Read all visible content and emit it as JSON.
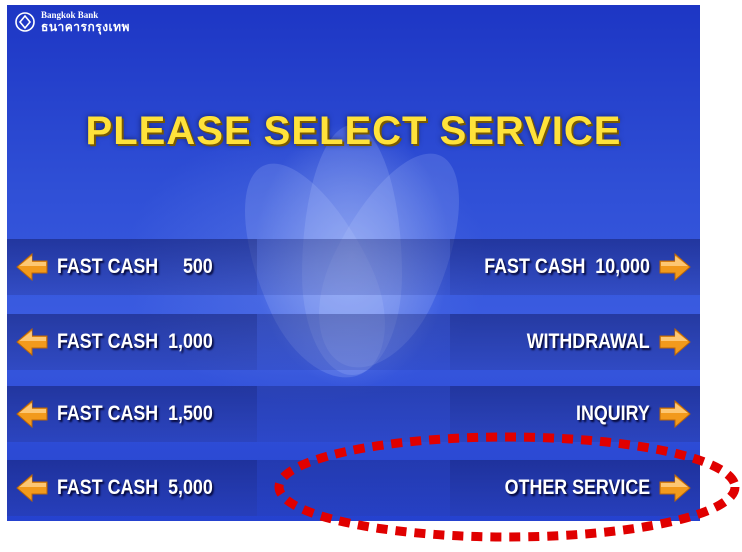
{
  "bank": {
    "name_en": "Bangkok Bank",
    "name_th": "ธนาคารกรุงเทพ"
  },
  "screen_title": "PLEASE  SELECT  SERVICE",
  "left_options": [
    {
      "label": "FAST CASH     500"
    },
    {
      "label": "FAST CASH  1,000"
    },
    {
      "label": "FAST CASH  1,500"
    },
    {
      "label": "FAST CASH  5,000"
    }
  ],
  "right_options": [
    {
      "label": "FAST CASH  10,000"
    },
    {
      "label": "WITHDRAWAL"
    },
    {
      "label": "INQUIRY"
    },
    {
      "label": "OTHER SERVICE"
    }
  ],
  "colors": {
    "title": "#ffe23a",
    "arrow": "#f29a1c",
    "highlight": "#e00000"
  }
}
